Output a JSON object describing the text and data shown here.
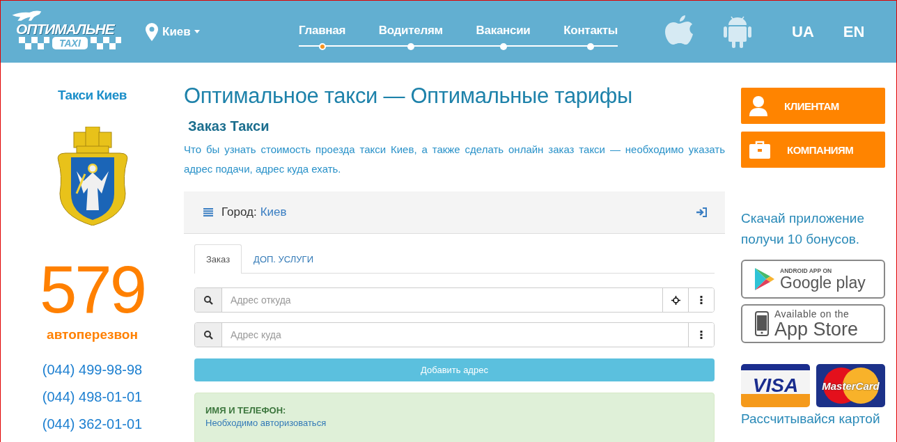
{
  "header": {
    "logo": {
      "title": "ОПТИМАЛЬНЕ",
      "subtitle": "TAXI"
    },
    "city": "Киев",
    "nav": [
      {
        "label": "Главная",
        "selected": true
      },
      {
        "label": "Водителям",
        "selected": false
      },
      {
        "label": "Вакансии",
        "selected": false
      },
      {
        "label": "Контакты",
        "selected": false
      }
    ],
    "languages": [
      "UA",
      "EN"
    ]
  },
  "sidebar": {
    "title": "Такси Киев",
    "callback_number": "579",
    "callback_label": "автоперезвон",
    "phones": [
      "(044) 499-98-98",
      "(044) 498-01-01",
      "(044) 362-01-01"
    ]
  },
  "main": {
    "title": "Оптимальное такси — Оптимальные тарифы",
    "subtitle": "Заказ Такси",
    "intro": "Что бы узнать стоимость проезда такси Киев, а также сделать онлайн заказ такси — необходимо указать адрес подачи, адрес куда ехать.",
    "city_panel": {
      "label": "Город:",
      "city": "Киев"
    },
    "tabs": [
      {
        "label": "Заказ",
        "selected": true
      },
      {
        "label": "ДОП. УСЛУГИ",
        "selected": false
      }
    ],
    "address_fields": [
      {
        "placeholder": "Адрес откуда",
        "kind": "locate"
      },
      {
        "placeholder": "Адрес куда",
        "kind": "plain"
      }
    ],
    "add_button": "Добавить адрес",
    "contact_alert": {
      "title": "ИМЯ И ТЕЛЕФОН:",
      "link": "Необходимо авторизоваться"
    }
  },
  "aside": {
    "buttons": [
      {
        "label": "КЛИЕНТАМ",
        "kind": "person"
      },
      {
        "label": "КОМПАНИЯМ",
        "kind": "briefcase"
      }
    ],
    "app_promo": "Скачай приложение получи 10 бонусов.",
    "store_badges": [
      {
        "kind": "google",
        "top": "ANDROID APP ON",
        "bottom": "Google play"
      },
      {
        "kind": "apple",
        "top": "Available on the",
        "bottom": "App Store"
      }
    ],
    "cards": [
      {
        "kind": "visa",
        "label": "VISA"
      },
      {
        "kind": "mastercard",
        "label": "MasterCard"
      }
    ],
    "card_caption": "Рассчитывайся картой"
  }
}
